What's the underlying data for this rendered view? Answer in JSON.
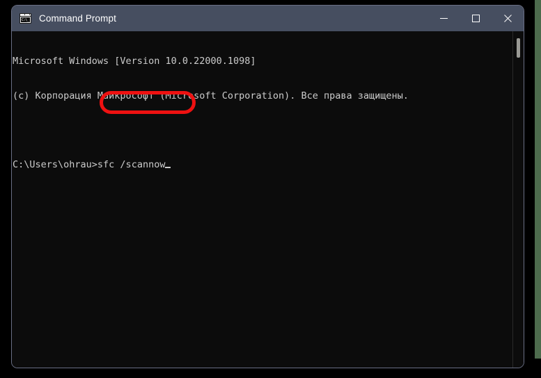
{
  "window": {
    "title": "Command Prompt",
    "icon": "command-prompt-icon",
    "icon_glyph": "C:\\_",
    "controls": [
      {
        "name": "minimize-button",
        "label": "Minimize",
        "glyph": "minimize-icon"
      },
      {
        "name": "maximize-button",
        "label": "Maximize",
        "glyph": "maximize-icon"
      },
      {
        "name": "close-button",
        "label": "Close",
        "glyph": "close-icon"
      }
    ]
  },
  "console": {
    "lines": [
      "Microsoft Windows [Version 10.0.22000.1098]",
      "(c) Корпорация Майкрософт (Microsoft Corporation). Все права защищены.",
      "",
      "C:\\Users\\ohrau>sfc /scannow"
    ],
    "line1": "Microsoft Windows [Version 10.0.22000.1098]",
    "line2": "(c) Корпорация Майкрософт (Microsoft Corporation). Все права защищены.",
    "line3": "",
    "prompt": "C:\\Users\\ohrau>",
    "command": "sfc /scannow",
    "cursor": "block-underscore"
  },
  "annotation": {
    "shape": "rounded-rectangle",
    "color": "#ee1111",
    "targets": ">sfc /scannow"
  },
  "scrollbar": {
    "orientation": "vertical",
    "thumb_position_percent": 2
  },
  "colors": {
    "titlebar": "#464e60",
    "console_background": "#0c0c0c",
    "console_text": "#cccccc",
    "annotation_red": "#ee1111",
    "desktop": "#4d6b4d"
  }
}
